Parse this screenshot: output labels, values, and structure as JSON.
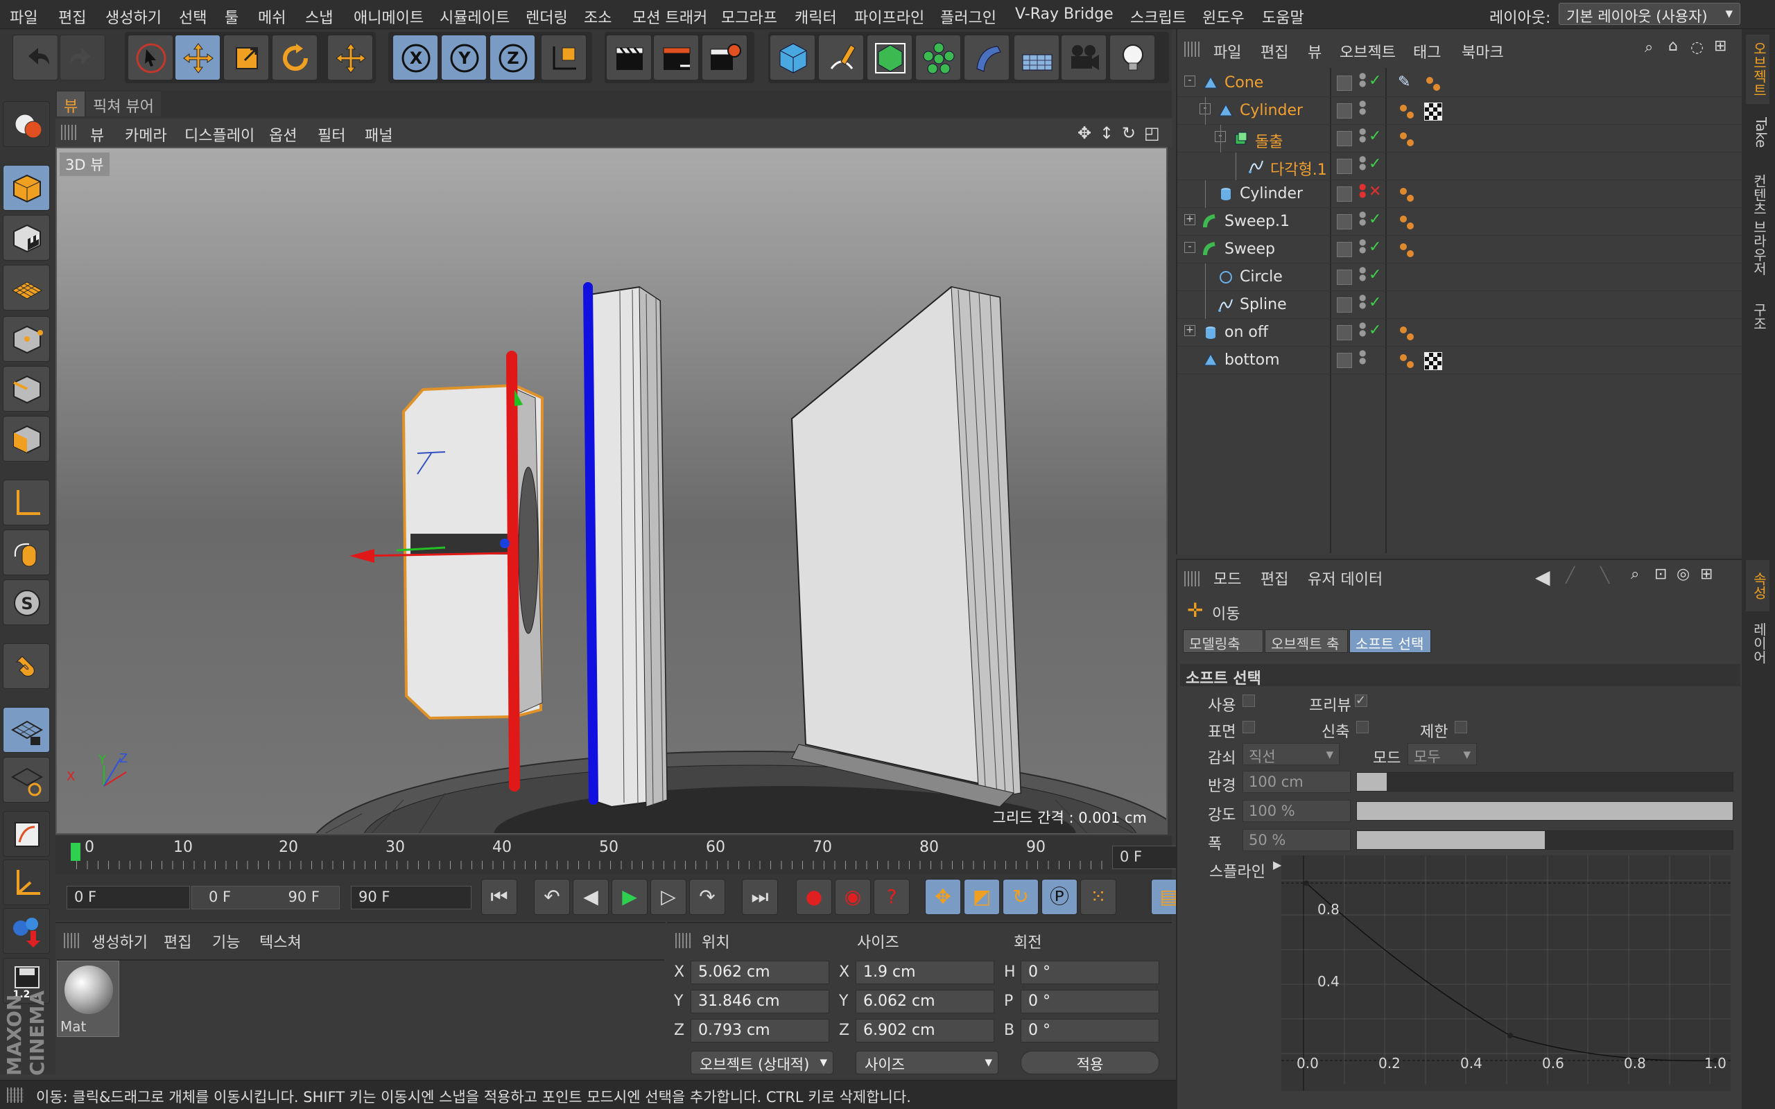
{
  "menu": [
    "파일",
    "편집",
    "생성하기",
    "선택",
    "툴",
    "메쉬",
    "스냅",
    "애니메이트",
    "시뮬레이트",
    "렌더링",
    "조소",
    "모션 트래커",
    "모그라프",
    "캐릭터",
    "파이프라인",
    "플러그인",
    "V-Ray Bridge",
    "스크립트",
    "윈도우",
    "도움말"
  ],
  "layout": {
    "label": "레이아웃:",
    "value": "기본 레이아웃 (사용자)"
  },
  "viewport": {
    "tabs": [
      "뷰",
      "픽쳐 뷰어"
    ],
    "menu": [
      "뷰",
      "카메라",
      "디스플레이",
      "옵션",
      "필터",
      "패널"
    ],
    "label": "3D 뷰",
    "grid": "그리드 간격 : 0.001 cm"
  },
  "timeline": {
    "ticks": [
      "0",
      "10",
      "20",
      "30",
      "40",
      "50",
      "60",
      "70",
      "80",
      "90"
    ],
    "frame": "0 F",
    "start": "0 F",
    "range_start": "0 F",
    "range_end": "90 F",
    "end": "90 F"
  },
  "material": {
    "menu": [
      "생성하기",
      "편집",
      "기능",
      "텍스쳐"
    ],
    "name": "Mat"
  },
  "coords": {
    "headers": [
      "위치",
      "사이즈",
      "회전"
    ],
    "pos": [
      {
        "axis": "X",
        "value": "5.062 cm"
      },
      {
        "axis": "Y",
        "value": "31.846 cm"
      },
      {
        "axis": "Z",
        "value": "0.793 cm"
      }
    ],
    "size": [
      {
        "axis": "X",
        "value": "1.9 cm"
      },
      {
        "axis": "Y",
        "value": "6.062 cm"
      },
      {
        "axis": "Z",
        "value": "6.902 cm"
      }
    ],
    "rot": [
      {
        "axis": "H",
        "value": "0 °"
      },
      {
        "axis": "P",
        "value": "0 °"
      },
      {
        "axis": "B",
        "value": "0 °"
      }
    ],
    "mode": "오브젝트 (상대적)",
    "size_mode": "사이즈",
    "apply": "적용"
  },
  "status": "이동: 클릭&드래그로 개체를 이동시킵니다. SHIFT 키는 이동시엔 스냅을 적용하고 포인트 모드시엔 선택을 추가합니다. CTRL 키로 삭제합니다.",
  "objects": {
    "menu": [
      "파일",
      "편집",
      "뷰",
      "오브젝트",
      "태그",
      "북마크"
    ],
    "rows": [
      {
        "name": "Cone",
        "indent": 0,
        "icon": "cone",
        "sel": true,
        "vis": "check",
        "exp": "-",
        "tags": [
          "sculpt",
          "dots"
        ]
      },
      {
        "name": "Cylinder",
        "indent": 1,
        "icon": "cone",
        "sel": true,
        "vis": "none",
        "exp": "-",
        "tags": [
          "dots",
          "checker"
        ]
      },
      {
        "name": "돌출",
        "indent": 2,
        "icon": "extrude",
        "sel": true,
        "vis": "check",
        "exp": "-",
        "tags": [
          "dots"
        ]
      },
      {
        "name": "다각형.1",
        "indent": 3,
        "icon": "spline",
        "sel": true,
        "vis": "check",
        "exp": "",
        "tags": []
      },
      {
        "name": "Cylinder",
        "indent": 1,
        "icon": "cyl",
        "sel": false,
        "vis": "cross",
        "exp": "",
        "tags": [
          "dots"
        ]
      },
      {
        "name": "Sweep.1",
        "indent": 0,
        "icon": "sweep",
        "sel": false,
        "vis": "check",
        "exp": "+",
        "tags": [
          "dots"
        ]
      },
      {
        "name": "Sweep",
        "indent": 0,
        "icon": "sweep",
        "sel": false,
        "vis": "check",
        "exp": "-",
        "tags": [
          "dots"
        ]
      },
      {
        "name": "Circle",
        "indent": 1,
        "icon": "circle",
        "sel": false,
        "vis": "check",
        "exp": "",
        "tags": []
      },
      {
        "name": "Spline",
        "indent": 1,
        "icon": "spline",
        "sel": false,
        "vis": "check",
        "exp": "",
        "tags": []
      },
      {
        "name": "on off",
        "indent": 0,
        "icon": "cyl",
        "sel": false,
        "vis": "check",
        "exp": "+",
        "tags": [
          "dots"
        ]
      },
      {
        "name": "bottom",
        "indent": 0,
        "icon": "cone",
        "sel": false,
        "vis": "none",
        "exp": "",
        "tags": [
          "dots",
          "checker"
        ]
      }
    ]
  },
  "attributes": {
    "menu": [
      "모드",
      "편집",
      "유저 데이터"
    ],
    "tool": "이동",
    "tabs": [
      "모델링축",
      "오브젝트 축",
      "소프트 선택"
    ],
    "section": "소프트 선택",
    "use": "사용",
    "preview": "프리뷰",
    "surface": "표면",
    "rubber": "신축",
    "restrict": "제한",
    "falloff_label": "감쇠",
    "falloff": "직선",
    "mode_label": "모드",
    "mode": "모두",
    "radius_label": "반경",
    "radius": "100 cm",
    "radius_fill": 0.08,
    "strength_label": "강도",
    "strength": "100 %",
    "strength_fill": 1.0,
    "width_label": "폭",
    "width": "50 %",
    "width_fill": 0.5,
    "spline_label": "스플라인",
    "graph": {
      "x_ticks": [
        "0.0",
        "0.2",
        "0.4",
        "0.6",
        "0.8",
        "1.0"
      ],
      "y_ticks": [
        "0.8",
        "0.4"
      ]
    }
  },
  "right_tabs": [
    "오브젝트",
    "Take",
    "컨텐츠 브라우저",
    "구조",
    "속성",
    "레이어"
  ],
  "brand": "MAXON CINEMA"
}
